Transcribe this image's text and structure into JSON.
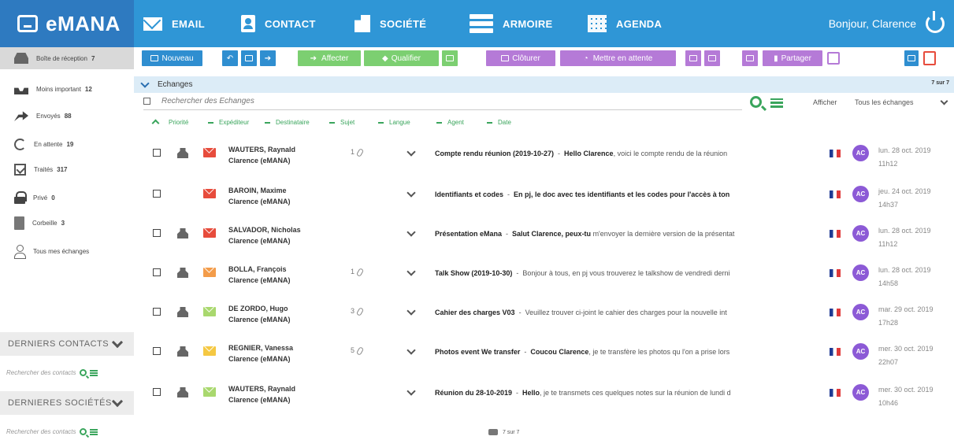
{
  "app": {
    "logo": "eMANA",
    "greeting": "Bonjour, Clarence"
  },
  "nav": [
    {
      "label": "EMAIL",
      "icon": "mail-icon"
    },
    {
      "label": "CONTACT",
      "icon": "contact-icon"
    },
    {
      "label": "SOCIÉTÉ",
      "icon": "building-icon"
    },
    {
      "label": "ARMOIRE",
      "icon": "cabinet-icon"
    },
    {
      "label": "AGENDA",
      "icon": "calendar-icon"
    }
  ],
  "sidebar": {
    "items": [
      {
        "label": "Boîte de réception",
        "count": "7",
        "icon": "inbox-icon"
      },
      {
        "label": "Moins important",
        "count": "12",
        "icon": "tray-icon"
      },
      {
        "label": "Envoyés",
        "count": "88",
        "icon": "send-arrow-icon"
      },
      {
        "label": "En attente",
        "count": "19",
        "icon": "clock-icon"
      },
      {
        "label": "Traités",
        "count": "317",
        "icon": "checkbox-icon"
      },
      {
        "label": "Privé",
        "count": "0",
        "icon": "lock-icon"
      },
      {
        "label": "Corbeille",
        "count": "3",
        "icon": "trash-icon"
      },
      {
        "label": "Tous mes échanges",
        "count": "",
        "icon": "person-icon"
      }
    ],
    "contacts_title": "DERNIERS CONTACTS",
    "contacts_search": "Rechercher des contacts",
    "companies_title": "DERNIERES SOCIÉTÉS",
    "companies_search": "Rechercher des contacts"
  },
  "toolbar": {
    "new_label": "Nouveau",
    "assign_label": "Affecter",
    "qualify_label": "Qualifier",
    "close_label": "Clôturer",
    "hold_label": "Mettre en attente",
    "share_label": "Partager",
    "colors": {
      "blue": "#2F8ED0",
      "green": "#7ccf71",
      "purple": "#b57ad7",
      "red": "#e74c3c"
    }
  },
  "exchanges": {
    "title": "Echanges",
    "count": "7 sur 7",
    "search_placeholder": "Rechercher des Echanges",
    "show_label": "Afficher",
    "show_value": "Tous les échanges",
    "sort_fields": [
      "Priorité",
      "Expéditeur",
      "Destinataire",
      "Sujet",
      "Langue",
      "Agent",
      "Date"
    ]
  },
  "emails": [
    {
      "sender": "WAUTERS, Raynald",
      "recipient": "Clarence (eMANA)",
      "attachments": "1",
      "subject": "Compte rendu réunion (2019-10-27)",
      "preview_bold": "Hello Clarence",
      "preview": ", voici le compte rendu de la réunion",
      "agent": "AC",
      "date": "lun. 28 oct. 2019",
      "time": "11h12",
      "env_color": "#e74c3c",
      "tray": true
    },
    {
      "sender": "BAROIN, Maxime",
      "recipient": "Clarence (eMANA)",
      "attachments": "",
      "subject": "Identifiants et codes",
      "preview_bold": "En pj, le doc avec tes identifiants et les codes pour l'accès à ton",
      "preview": "",
      "agent": "AC",
      "date": "jeu. 24 oct. 2019",
      "time": "14h37",
      "env_color": "#e74c3c",
      "tray": false
    },
    {
      "sender": "SALVADOR, Nicholas",
      "recipient": "Clarence (eMANA)",
      "attachments": "",
      "subject": "Présentation eMana",
      "preview_bold": "Salut Clarence, peux-tu",
      "preview": " m'envoyer la dernière version de la présentat",
      "agent": "AC",
      "date": "lun. 28 oct. 2019",
      "time": "11h12",
      "env_color": "#e74c3c",
      "tray": true
    },
    {
      "sender": "BOLLA, François",
      "recipient": "Clarence (eMANA)",
      "attachments": "1",
      "subject": "Talk Show (2019-10-30)",
      "preview_bold": "",
      "preview": "Bonjour à tous, en pj vous trouverez le talkshow de vendredi derni",
      "agent": "AC",
      "date": "lun. 28 oct. 2019",
      "time": "14h58",
      "env_color": "#f39c4a",
      "tray": true
    },
    {
      "sender": "DE ZORDO, Hugo",
      "recipient": "Clarence (eMANA)",
      "attachments": "3",
      "subject": "Cahier des charges V03",
      "preview_bold": "",
      "preview": "Veuillez trouver ci-joint le cahier des charges pour la nouvelle int",
      "agent": "AC",
      "date": "mar. 29 oct. 2019",
      "time": "17h28",
      "env_color": "#a9d86e",
      "tray": true
    },
    {
      "sender": "REGNIER, Vanessa",
      "recipient": "Clarence (eMANA)",
      "attachments": "5",
      "subject": "Photos event We transfer",
      "preview_bold": "Coucou Clarence",
      "preview": ", je te transfère les photos qu l'on a prise lors",
      "agent": "AC",
      "date": "mer. 30 oct. 2019",
      "time": "22h07",
      "env_color": "#f5c842",
      "tray": true
    },
    {
      "sender": "WAUTERS, Raynald",
      "recipient": "Clarence (eMANA)",
      "attachments": "",
      "subject": "Réunion du 28-10-2019",
      "preview_bold": "Hello",
      "preview": ", je te transmets ces quelques notes sur la réunion de lundi d",
      "agent": "AC",
      "date": "mer. 30 oct. 2019",
      "time": "10h46",
      "env_color": "#a9d86e",
      "tray": true
    }
  ],
  "pager": {
    "label": "7 sur 7"
  }
}
